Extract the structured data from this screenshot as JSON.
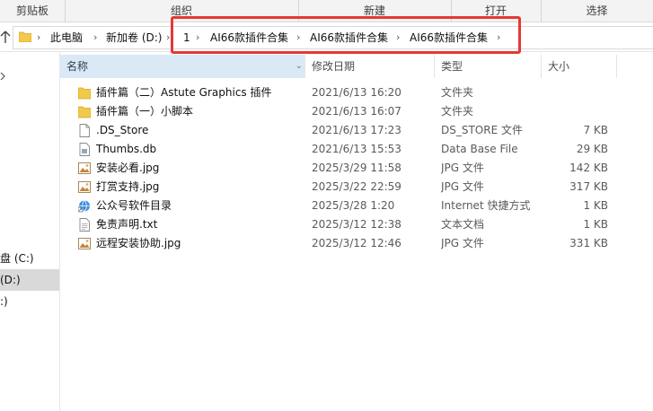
{
  "ribbon": {
    "groups": [
      "剪贴板",
      "组织",
      "新建",
      "打开",
      "选择"
    ]
  },
  "address": {
    "crumbs": [
      "此电脑",
      "新加卷 (D:)",
      "1",
      "AI66款插件合集",
      "AI66款插件合集",
      "AI66款插件合集"
    ]
  },
  "nav": {
    "items": [
      "盘 (C:)",
      "(D:)",
      ":)"
    ],
    "selected_index": 1
  },
  "columns": {
    "name": "名称",
    "date": "修改日期",
    "type": "类型",
    "size": "大小"
  },
  "files": [
    {
      "icon": "folder-icon",
      "name": "插件篇（二）Astute Graphics 插件",
      "date": "2021/6/13 16:20",
      "type": "文件夹",
      "size": ""
    },
    {
      "icon": "folder-icon",
      "name": "插件篇（一）小脚本",
      "date": "2021/6/13 16:07",
      "type": "文件夹",
      "size": ""
    },
    {
      "icon": "file-icon",
      "name": ".DS_Store",
      "date": "2021/6/13 17:23",
      "type": "DS_STORE 文件",
      "size": "7 KB"
    },
    {
      "icon": "db-file-icon",
      "name": "Thumbs.db",
      "date": "2021/6/13 15:53",
      "type": "Data Base File",
      "size": "29 KB"
    },
    {
      "icon": "image-file-icon",
      "name": "安装必看.jpg",
      "date": "2025/3/29 11:58",
      "type": "JPG 文件",
      "size": "142 KB"
    },
    {
      "icon": "image-file-icon",
      "name": "打赏支持.jpg",
      "date": "2025/3/22 22:59",
      "type": "JPG 文件",
      "size": "317 KB"
    },
    {
      "icon": "internet-shortcut-icon",
      "name": "公众号软件目录",
      "date": "2025/3/28 1:20",
      "type": "Internet 快捷方式",
      "size": "1 KB"
    },
    {
      "icon": "text-file-icon",
      "name": "免责声明.txt",
      "date": "2025/3/12 12:38",
      "type": "文本文档",
      "size": "1 KB"
    },
    {
      "icon": "image-file-icon",
      "name": "远程安装协助.jpg",
      "date": "2025/3/12 12:46",
      "type": "JPG 文件",
      "size": "331 KB"
    }
  ],
  "colors": {
    "highlight_border": "#e53935",
    "folder": "#f2c94c",
    "selected_column": "#dbe9f7",
    "selected_nav": "#d9d9d9"
  }
}
